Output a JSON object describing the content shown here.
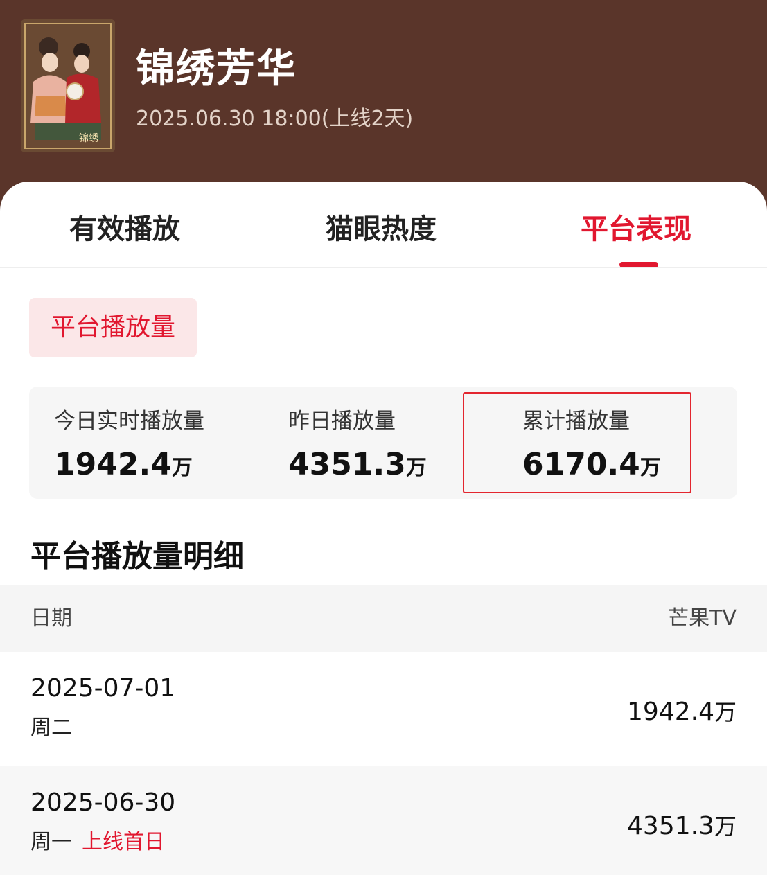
{
  "show": {
    "title": "锦绣芳华",
    "release_info": "2025.06.30 18:00(上线2天)",
    "poster_text": "锦绣芳华"
  },
  "tabs": [
    {
      "label": "有效播放",
      "active": false
    },
    {
      "label": "猫眼热度",
      "active": false
    },
    {
      "label": "平台表现",
      "active": true
    }
  ],
  "filter_chip": "平台播放量",
  "stats": [
    {
      "label": "今日实时播放量",
      "value": "1942.4",
      "unit": "万"
    },
    {
      "label": "昨日播放量",
      "value": "4351.3",
      "unit": "万"
    },
    {
      "label": "累计播放量",
      "value": "6170.4",
      "unit": "万",
      "highlighted": true
    }
  ],
  "detail": {
    "title": "平台播放量明细",
    "columns": {
      "date": "日期",
      "platform": "芒果TV"
    },
    "rows": [
      {
        "date": "2025-07-01",
        "weekday": "周二",
        "tag": "",
        "value": "1942.4",
        "unit": "万"
      },
      {
        "date": "2025-06-30",
        "weekday": "周一",
        "tag": "上线首日",
        "value": "4351.3",
        "unit": "万"
      }
    ]
  },
  "colors": {
    "header_bg": "#5a352a",
    "accent": "#e1172f",
    "chip_bg": "#fbe7e8",
    "highlight_border": "#e3262f"
  }
}
